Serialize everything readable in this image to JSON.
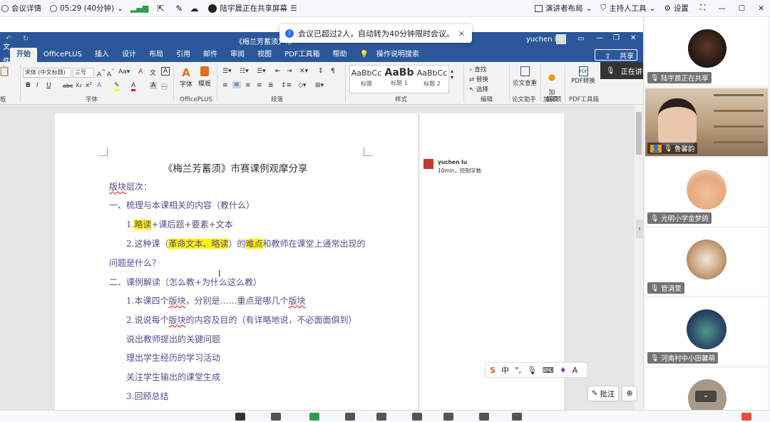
{
  "meeting_bar": {
    "details_label": "会议详情",
    "timer": "05:29 (40分钟)",
    "sharing_label": "陆宇晨正在共享屏幕",
    "layout_label": "演讲者布局",
    "host_tools_label": "主持人工具",
    "settings_label": "设置"
  },
  "toast": {
    "message": "会议已超过2人，自动转为40分钟限时会议。"
  },
  "word": {
    "title": "《梅兰芳蓄须》市",
    "user": "yuchen lu",
    "menus": [
      "文件",
      "开始",
      "OfficePLUS",
      "插入",
      "设计",
      "布局",
      "引用",
      "邮件",
      "审阅",
      "视图",
      "PDF工具箱",
      "帮助",
      "操作说明搜索"
    ],
    "share_label": "共享",
    "speaking": "正在讲话：陆宇晨;",
    "ribbon": {
      "font_name": "宋体 (中文标题)",
      "font_size": "三号",
      "group_font": "字体",
      "group_officeplus": "OfficePLUS",
      "group_paragraph": "段落",
      "group_styles": "样式",
      "group_edit": "编辑",
      "group_paper": "论文助手",
      "group_addins": "加载项",
      "group_pdf": "PDF工具箱",
      "btn_font": "字体",
      "btn_template": "模板",
      "styles": [
        {
          "sample": "AaBbCc",
          "name": "标题"
        },
        {
          "sample": "AaBb",
          "name": "标题 1"
        },
        {
          "sample": "AaBbCc",
          "name": "标题 2"
        }
      ],
      "find": "查找",
      "replace": "替换",
      "select": "选择",
      "paper_check": "论文查重",
      "addin": "加\n载项",
      "pdf_convert": "PDF转换"
    },
    "doc": {
      "title": "《梅兰芳蓄须》市赛课例观摩分享",
      "l1a": "版块",
      "l1b": "层次：",
      "l2": "一、梳理与本课相关的内容（教什么）",
      "l3_pre": "1.",
      "l3_hl": "略读",
      "l3_post": "+课后题+要素+文本",
      "l4_pre": "2.这种课（",
      "l4_hl": "革命文本、略读",
      "l4_mid": "）的",
      "l4_hl2": "难点",
      "l4_post": "和教师在课堂上通常出现的",
      "l5": "问题是什么？",
      "l6": "二、课例解读（怎么教+为什么这么教）",
      "l7_a": "1.本课四个",
      "l7_b": "版块",
      "l7_c": "，分别是……重点是哪几个",
      "l7_d": "版块",
      "l8_a": "2.说说每个",
      "l8_b": "版块",
      "l8_c": "的内容及目的（有详略地说，不必面面俱到）",
      "l9": "说出教师提出的关键问题",
      "l10": "理出学生经历的学习活动",
      "l11": "关注学生输出的课堂生成",
      "l12": "3.回顾总结"
    },
    "comment": {
      "author": "yuchen lu",
      "text": "10min，控制字数"
    },
    "annotate_label": "批注",
    "ime": [
      "中"
    ]
  },
  "participants": [
    {
      "name": "陆宇晨正在共享"
    },
    {
      "name": "鲁馨韵"
    },
    {
      "name": "光明小学金梦鸽"
    },
    {
      "name": "管涓雯"
    },
    {
      "name": "河南村中小田馨萌"
    }
  ]
}
